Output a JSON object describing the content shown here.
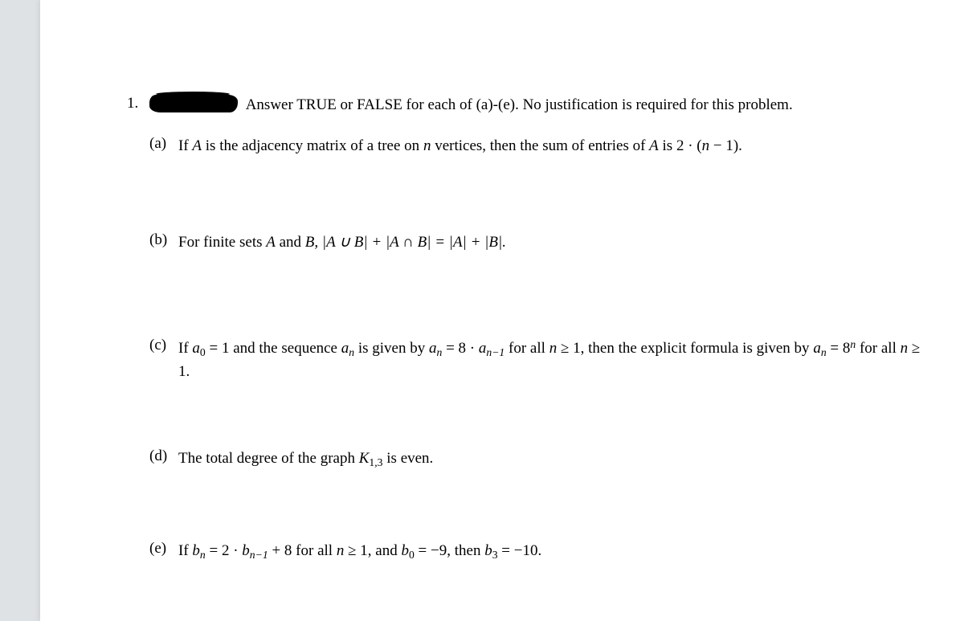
{
  "problem_number": "1.",
  "intro": " Answer TRUE or FALSE for each of (a)-(e). No justification is required for this problem.",
  "parts": {
    "a": {
      "label": "(a)",
      "pre": "If ",
      "A": "A",
      "mid1": " is the adjacency matrix of a tree on ",
      "n": "n",
      "mid2": " vertices, then the sum of entries of ",
      "A2": "A",
      "mid3": " is 2 · (",
      "n2": "n",
      "tail": " − 1)."
    },
    "b": {
      "label": "(b)",
      "pre": "For finite sets ",
      "A": "A",
      "and": " and ",
      "B": "B",
      "formula": ", |A ∪ B| + |A ∩ B| = |A| + |B|."
    },
    "c": {
      "label": "(c)",
      "pre": "If ",
      "a0_a": "a",
      "a0_sub": "0",
      "mid1": " = 1 and the sequence ",
      "an_a": "a",
      "an_sub": "n",
      "mid2": " is given by ",
      "an2_a": "a",
      "an2_sub": "n",
      "mid3": " = 8 · ",
      "anm1_a": "a",
      "anm1_sub": "n−1",
      "mid4": " for all ",
      "n": "n",
      "mid5": " ≥ 1, then the explicit formula is given by ",
      "an3_a": "a",
      "an3_sub": "n",
      "mid6": " = 8",
      "sup_n": "n",
      "mid7": " for all ",
      "n2": "n",
      "tail": " ≥ 1."
    },
    "d": {
      "label": "(d)",
      "pre": "The total degree of the graph ",
      "K": "K",
      "sub": "1,3",
      "tail": " is even."
    },
    "e": {
      "label": "(e)",
      "pre": "If ",
      "bn_b": "b",
      "bn_sub": "n",
      "mid1": " = 2 · ",
      "bnm1_b": "b",
      "bnm1_sub": "n−1",
      "mid2": " + 8 for all ",
      "n": "n",
      "mid3": " ≥ 1, and ",
      "b0_b": "b",
      "b0_sub": "0",
      "mid4": " = −9, then ",
      "b3_b": "b",
      "b3_sub": "3",
      "tail": " = −10."
    }
  }
}
